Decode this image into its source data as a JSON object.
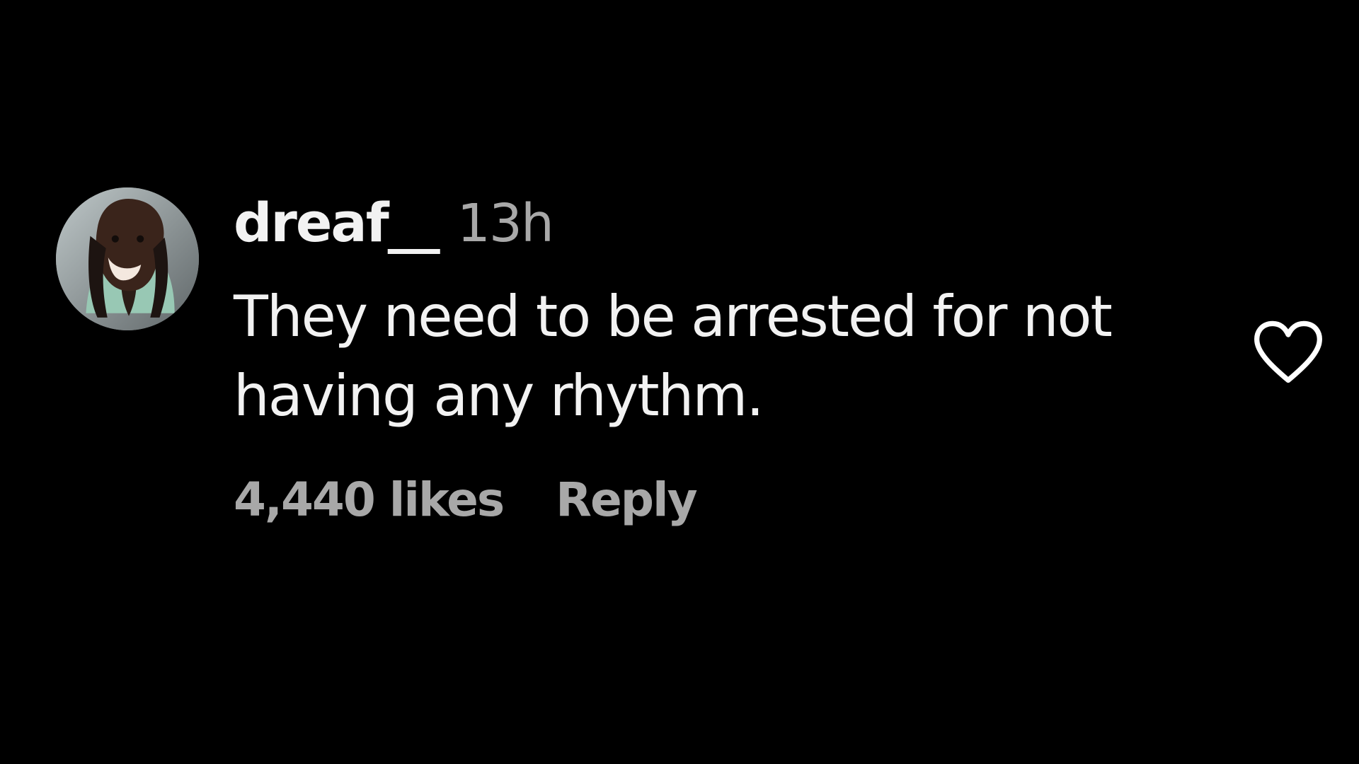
{
  "comment": {
    "username": "dreaf__",
    "timestamp": "13h",
    "text": "They need to be arrested for not having any rhythm.",
    "likes": "4,440 likes",
    "reply_label": "Reply",
    "liked": false
  },
  "icons": {
    "avatar": "profile-photo",
    "like": "heart-outline-icon"
  },
  "colors": {
    "background": "#000000",
    "primary_text": "#f2f2f2",
    "secondary_text": "#a8a8a8"
  }
}
